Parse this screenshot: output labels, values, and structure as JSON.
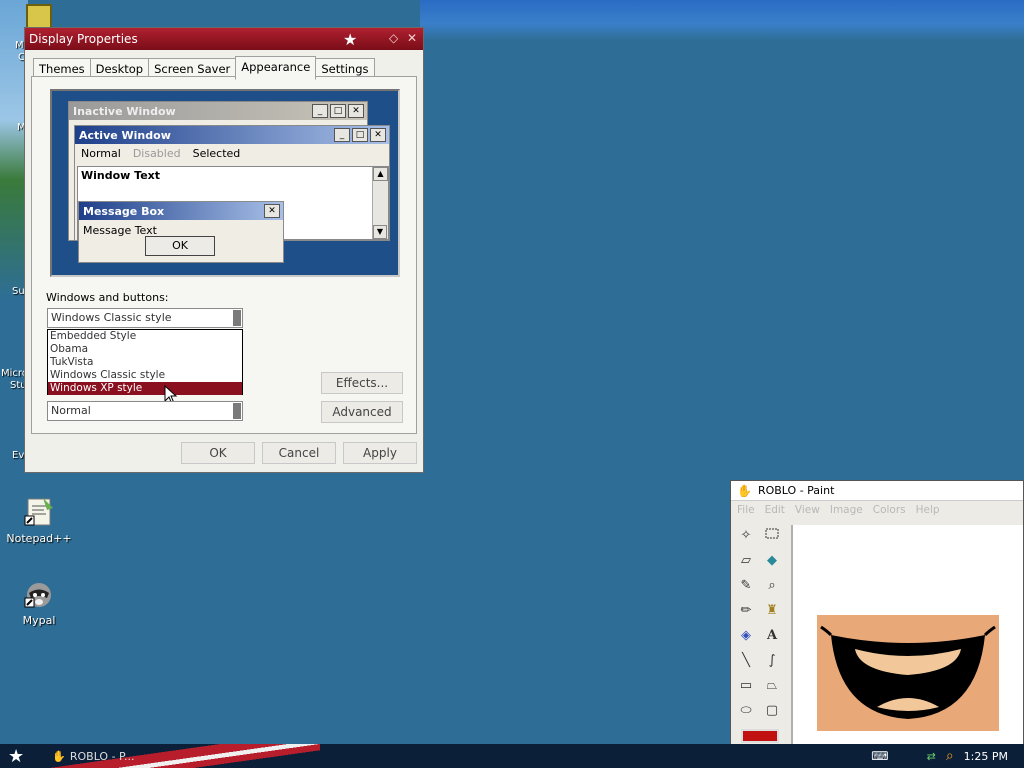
{
  "desktop": {
    "icons": [
      {
        "label": "Notepad++"
      },
      {
        "label": "Mypal"
      }
    ],
    "partial_labels": [
      "M",
      "C",
      "M",
      "Su",
      "Micro",
      "Stu",
      "Ev"
    ]
  },
  "display_properties": {
    "title": "Display Properties",
    "tabs": [
      "Themes",
      "Desktop",
      "Screen Saver",
      "Appearance",
      "Settings"
    ],
    "active_tab": "Appearance",
    "preview": {
      "inactive_window": "Inactive Window",
      "active_window": "Active Window",
      "menu": [
        "Normal",
        "Disabled",
        "Selected"
      ],
      "window_text": "Window Text",
      "message_box": "Message Box",
      "message_text": "Message Text",
      "ok": "OK"
    },
    "windows_buttons_label": "Windows and buttons:",
    "windows_buttons_value": "Windows Classic style",
    "dropdown_options": [
      "Embedded Style",
      "Obama",
      "TukVista",
      "Windows Classic style",
      "Windows XP style"
    ],
    "dropdown_selected": "Windows XP style",
    "font_size_value": "Normal",
    "effects_button": "Effects...",
    "advanced_button": "Advanced",
    "ok_button": "OK",
    "cancel_button": "Cancel",
    "apply_button": "Apply"
  },
  "paint": {
    "title": "ROBLO - Paint",
    "menu": [
      "File",
      "Edit",
      "View",
      "Image",
      "Colors",
      "Help"
    ]
  },
  "taskbar": {
    "task_label": "ROBLO - P...",
    "time": "1:25 PM"
  },
  "colors": {
    "desktop": "#2e6e96",
    "titlebar": "#b02030",
    "selection": "#8a1020"
  }
}
